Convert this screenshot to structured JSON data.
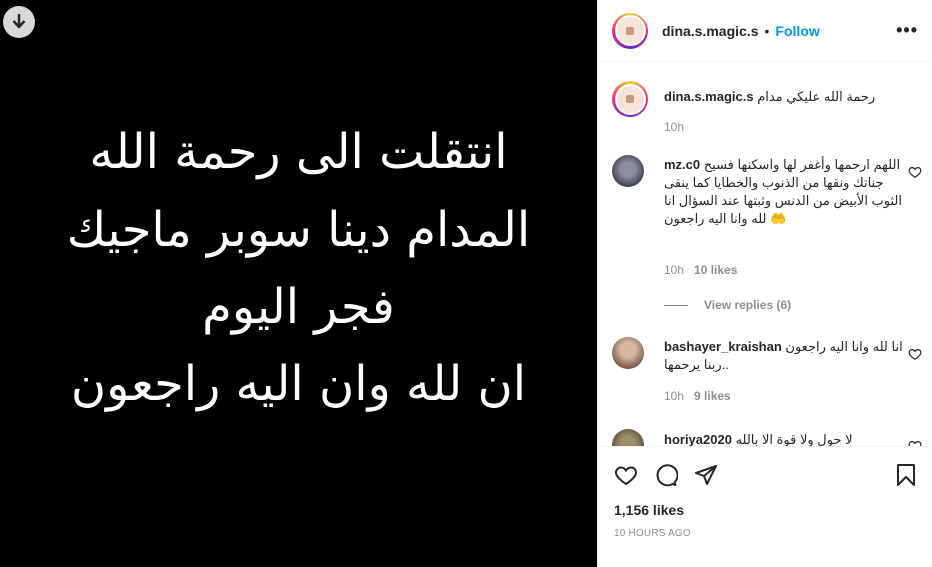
{
  "post": {
    "lines": [
      "انتقلت الى رحمة الله",
      "المدام دينا سوبر ماجيك",
      "فجر اليوم",
      "ان لله وان اليه راجعون"
    ]
  },
  "header": {
    "username": "dina.s.magic.s",
    "separator": "•",
    "follow_label": "Follow",
    "more_label": "•••"
  },
  "caption": {
    "username": "dina.s.magic.s",
    "text": "رحمة الله عليكي مدام",
    "time": "10h"
  },
  "comments": [
    {
      "username": "mz.c0",
      "text": "اللهم ارحمها وأغفر لها واسكنها فسيح جناتك ونقها من الذنوب والخطايا كما ينقى الثوب الأبيض من الدنس وثبتها عند السؤال انا لله وانا اليه راجعون 🤲",
      "time": "10h",
      "likes": "10 likes",
      "view_replies": "View replies (6)"
    },
    {
      "username": "bashayer_kraishan",
      "text": "انا لله وانا اليه راجعون ..ربنا يرحمها",
      "time": "10h",
      "likes": "9 likes"
    },
    {
      "username": "horiya2020",
      "text": "لا حول ولا قوة الا بالله"
    }
  ],
  "footer": {
    "likes": "1,156 likes",
    "time": "10 HOURS AGO"
  },
  "icons": {
    "download": "download-icon",
    "like": "heart-icon",
    "comment": "comment-icon",
    "share": "share-icon",
    "save": "bookmark-icon",
    "more": "more-icon"
  },
  "colors": {
    "link": "#0095f6",
    "muted": "#8e8e8e",
    "text": "#262626",
    "image_bg": "#000000"
  }
}
